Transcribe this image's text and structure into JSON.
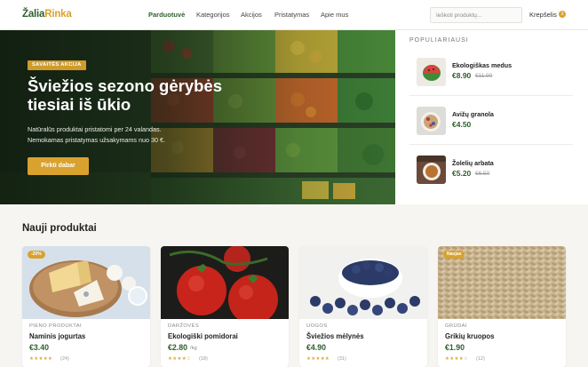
{
  "header": {
    "logo_part1": "Žalia",
    "logo_part2": "Rinka",
    "nav": [
      "Parduotuvė",
      "Kategorijos",
      "Akcijos",
      "Pristatymas",
      "Apie mus"
    ],
    "search_placeholder": "Ieškoti produktų...",
    "cart_label": "Krepšelis",
    "cart_count": "3"
  },
  "hero": {
    "badge": "SAVAITĖS AKCIJA",
    "title": "Šviežios sezono gėrybės tiesiai iš ūkio",
    "subtitle": "Natūralūs produktai pristatomi per 24 valandas. Nemokamas pristatymas užsakymams nuo 30 €.",
    "button": "Pirkti dabar"
  },
  "popular": {
    "title": "POPULIARIAUSI",
    "items": [
      {
        "name": "Ekologiškas medus",
        "price": "€8.90",
        "old_price": "€11.90"
      },
      {
        "name": "Avižų granola",
        "price": "€4.50",
        "old_price": ""
      },
      {
        "name": "Žolelių arbata",
        "price": "€5.20",
        "old_price": "€6.50"
      }
    ]
  },
  "products": {
    "title": "Nauji produktai",
    "items": [
      {
        "tag": "-20%",
        "category": "PIENO PRODUKTAI",
        "name": "Naminis jogurtas",
        "price": "€3.40",
        "unit": "",
        "stars": "★★★★★",
        "reviews": "(24)"
      },
      {
        "tag": "",
        "category": "DARŽOVĖS",
        "name": "Ekologiški pomidorai",
        "price": "€2.80",
        "unit": "/kg",
        "stars": "★★★★☆",
        "reviews": "(18)"
      },
      {
        "tag": "",
        "category": "UOGOS",
        "name": "Šviežios mėlynės",
        "price": "€4.90",
        "unit": "",
        "stars": "★★★★★",
        "reviews": "(31)"
      },
      {
        "tag": "Naujas",
        "category": "GRŪDAI",
        "name": "Grikių kruopos",
        "price": "€1.90",
        "unit": "",
        "stars": "★★★★☆",
        "reviews": "(12)"
      }
    ]
  },
  "colors": {
    "brand_green": "#2e5f2c",
    "accent_gold": "#d9a22e"
  }
}
